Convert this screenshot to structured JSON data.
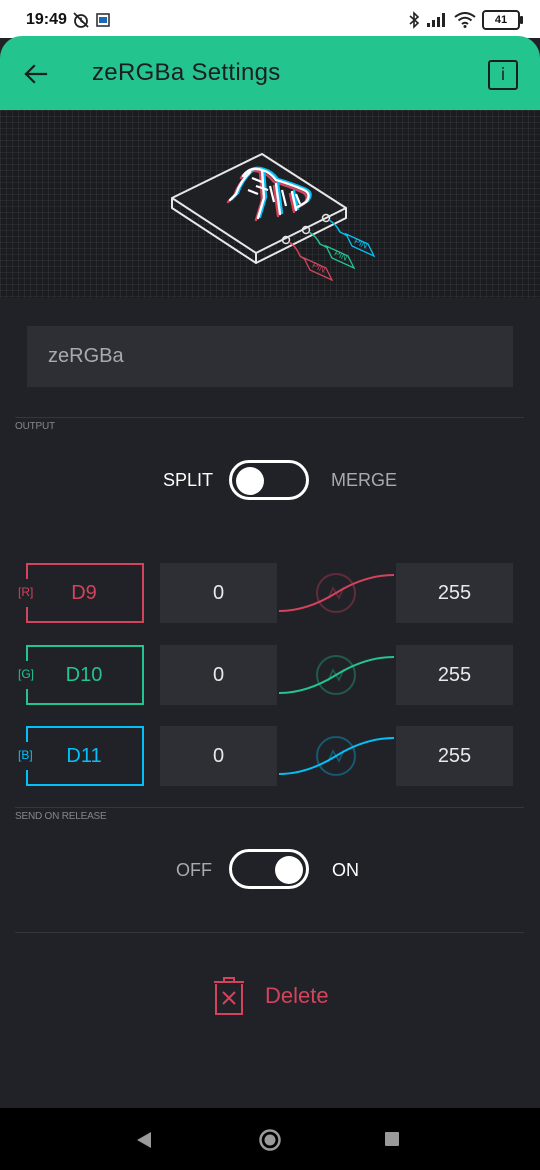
{
  "status_bar": {
    "time": "19:49",
    "battery": "41",
    "icons": [
      "alarm-off-icon",
      "gallery-icon",
      "bluetooth-icon",
      "signal-icon",
      "wifi-icon",
      "battery-icon"
    ]
  },
  "app_bar": {
    "title": "zeRGBa Settings",
    "back_icon": "arrow-left-icon",
    "info_label": "i"
  },
  "hero": {
    "illustration": "zebra-device-illustration",
    "pin_labels": [
      "PIN",
      "PIN",
      "PIN"
    ]
  },
  "name_field": {
    "value": "zeRGBa"
  },
  "output": {
    "section_label": "OUTPUT",
    "left_label": "SPLIT",
    "right_label": "MERGE",
    "state": "split"
  },
  "pins": [
    {
      "tag": "[R]",
      "pin": "D9",
      "min": "0",
      "max": "255",
      "color": "#d3435c"
    },
    {
      "tag": "[G]",
      "pin": "D10",
      "min": "0",
      "max": "255",
      "color": "#23c48e"
    },
    {
      "tag": "[B]",
      "pin": "D11",
      "min": "0",
      "max": "255",
      "color": "#04c0f8"
    }
  ],
  "send_on_release": {
    "section_label": "SEND ON RELEASE",
    "left_label": "OFF",
    "right_label": "ON",
    "state": "on"
  },
  "delete": {
    "label": "Delete",
    "icon": "trash-icon"
  },
  "colors": {
    "accent": "#23c48e",
    "background": "#212227",
    "danger": "#d3435c",
    "red": "#d3435c",
    "green": "#23c48e",
    "blue": "#04c0f8"
  },
  "nav_bar": {
    "icons": [
      "nav-back-icon",
      "nav-home-icon",
      "nav-recents-icon"
    ]
  }
}
